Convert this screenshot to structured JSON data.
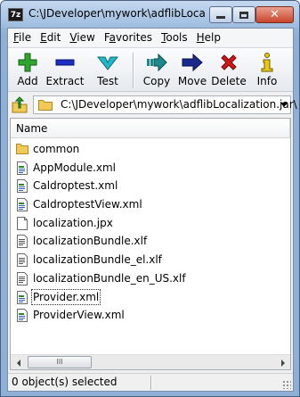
{
  "window": {
    "title": "C:\\JDeveloper\\mywork\\adflibLocal...",
    "app_icon_text": "7z"
  },
  "menu": [
    {
      "label": "File",
      "underline": "F",
      "rest": "ile"
    },
    {
      "label": "Edit",
      "underline": "E",
      "rest": "dit"
    },
    {
      "label": "View",
      "underline": "V",
      "rest": "iew"
    },
    {
      "label": "Favorites",
      "underline": "a",
      "pre": "F",
      "rest": "vorites"
    },
    {
      "label": "Tools",
      "underline": "T",
      "rest": "ools"
    },
    {
      "label": "Help",
      "underline": "H",
      "rest": "elp"
    }
  ],
  "toolbar": {
    "add": "Add",
    "extract": "Extract",
    "test": "Test",
    "copy": "Copy",
    "move": "Move",
    "delete": "Delete",
    "info": "Info"
  },
  "address": {
    "path": "C:\\JDeveloper\\mywork\\adflibLocalization.jar\\"
  },
  "list": {
    "column_name": "Name",
    "items": [
      {
        "name": "common",
        "icon": "folder-icon"
      },
      {
        "name": "AppModule.xml",
        "icon": "xml-file-icon"
      },
      {
        "name": "Caldroptest.xml",
        "icon": "xml-file-icon"
      },
      {
        "name": "CaldroptestView.xml",
        "icon": "xml-file-icon"
      },
      {
        "name": "localization.jpx",
        "icon": "file-icon"
      },
      {
        "name": "localizationBundle.xlf",
        "icon": "document-file-icon"
      },
      {
        "name": "localizationBundle_el.xlf",
        "icon": "document-file-icon"
      },
      {
        "name": "localizationBundle_en_US.xlf",
        "icon": "document-file-icon"
      },
      {
        "name": "Provider.xml",
        "icon": "xml-file-icon"
      },
      {
        "name": "ProviderView.xml",
        "icon": "xml-file-icon"
      }
    ]
  },
  "scrollbar": {
    "thumb_grip": "III"
  },
  "status": {
    "text": "0 object(s) selected"
  },
  "colors": {
    "add_green": "#2ea52e",
    "extract_blue": "#1c2ec4",
    "test_cyan": "#1fb8c9",
    "copy_teal": "#1c8a8a",
    "move_navy": "#1a2a8c",
    "delete_red": "#d01818",
    "info_yellow": "#e8c810",
    "folder_yellow": "#f2c955"
  }
}
